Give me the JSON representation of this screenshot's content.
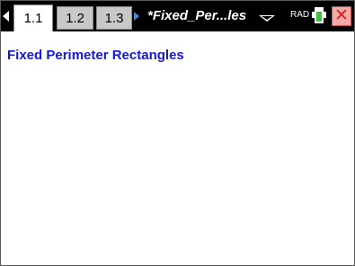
{
  "tabs": [
    {
      "label": "1.1",
      "active": true
    },
    {
      "label": "1.2",
      "active": false
    },
    {
      "label": "1.3",
      "active": false
    }
  ],
  "document": {
    "title": "*Fixed_Per...les",
    "mode": "RAD",
    "battery_level": 0.75,
    "close_glyph": "✕"
  },
  "page": {
    "heading": "Fixed Perimeter Rectangles"
  },
  "colors": {
    "heading": "#1414e6",
    "nav_arrow": "#2e8fe8",
    "battery_fill": "#37c43a",
    "close": "#d82020"
  }
}
